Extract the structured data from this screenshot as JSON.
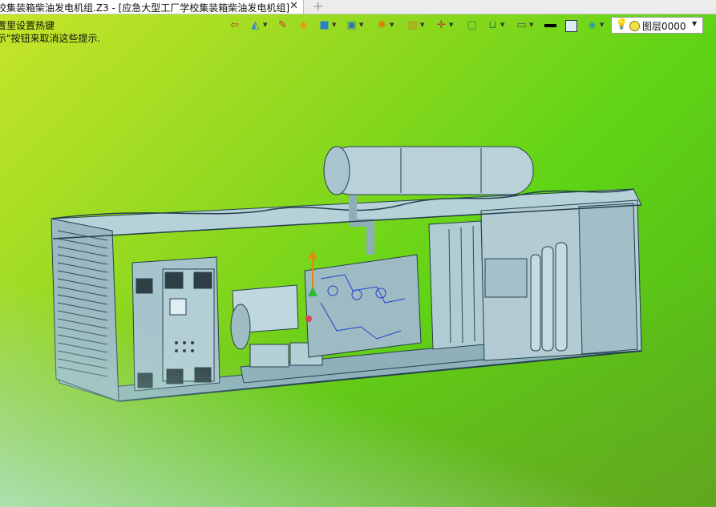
{
  "tab": {
    "title": "校集装箱柴油发电机组.Z3 - [应急大型工厂学校集装箱柴油发电机组]",
    "close_glyph": "✕",
    "new_tab_glyph": "+"
  },
  "hints": {
    "line1": "置里设置热键",
    "line2": "示\"按钮来取消这些提示."
  },
  "toolbar": {
    "icons": [
      "import-icon",
      "paint-bucket-icon",
      "pencil-icon",
      "shaded-cube-icon",
      "view-cube-icon",
      "view-orientation-icon",
      "render-mode-icon",
      "frame-icon",
      "axis-icon",
      "grid-icon",
      "dimension-icon",
      "display-icon",
      "line-color-swatch",
      "fill-color-swatch",
      "plane-icon"
    ],
    "layer": {
      "name": "图层0000"
    }
  },
  "colors": {
    "line_color": "#000000",
    "fill_color": "#d7ecf5",
    "layer_dot": "#f0e04a"
  }
}
